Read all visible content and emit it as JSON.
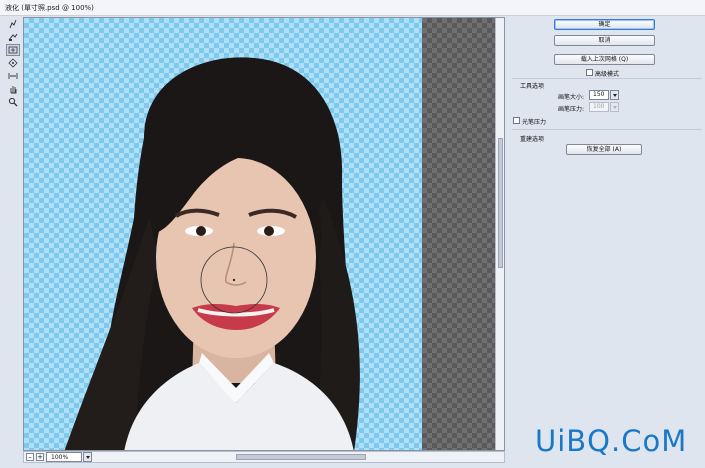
{
  "window": {
    "title": "液化 (單寸照.psd @ 100%)"
  },
  "tools": [
    {
      "name": "forward-warp-tool-icon"
    },
    {
      "name": "reconstruct-tool-icon"
    },
    {
      "name": "pucker-tool-icon",
      "active": true
    },
    {
      "name": "bloat-tool-icon"
    },
    {
      "name": "push-left-tool-icon"
    },
    {
      "name": "hand-tool-icon"
    },
    {
      "name": "zoom-tool-icon"
    }
  ],
  "canvas": {
    "zoom_value": "100%"
  },
  "panel": {
    "ok_label": "确定",
    "cancel_label": "取消",
    "load_last_mesh_label": "载入上次网格 (Q)",
    "advanced_mode_label": "高级模式",
    "advanced_mode_checked": false,
    "tool_options_heading": "工具选项",
    "brush_size_label": "画笔大小:",
    "brush_size_value": "150",
    "brush_pressure_label": "画笔压力:",
    "brush_pressure_value": "100",
    "stylus_pressure_label": "光笔压力",
    "stylus_pressure_checked": false,
    "reconstruct_heading": "重建选项",
    "restore_all_label": "恢复全部 (A)"
  },
  "watermark": {
    "text": "UiBQ.CoM"
  },
  "colors": {
    "accent": "#3d7bd2",
    "canvas_blue": "#aee0f8",
    "watermark": "#1a78c8"
  }
}
